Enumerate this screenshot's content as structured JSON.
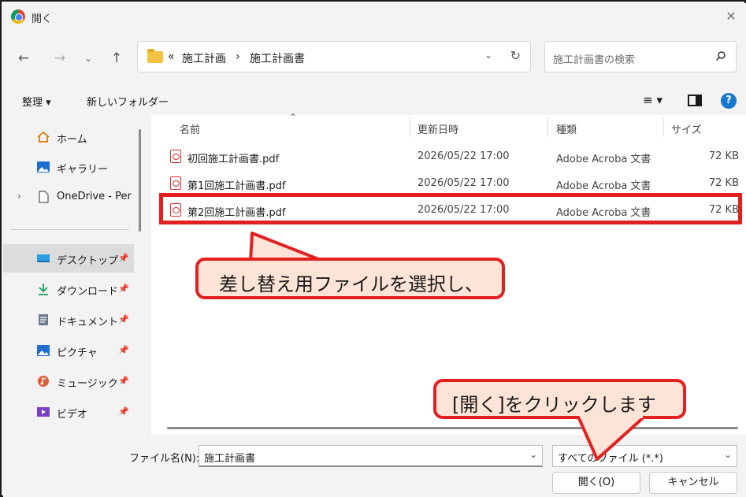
{
  "window": {
    "title": "開く"
  },
  "nav": {
    "breadcrumb_prefix": "«",
    "breadcrumb": [
      "施工計画",
      "施工計画書"
    ],
    "breadcrumb_sep": "›",
    "search_placeholder": "施工計画書の検索"
  },
  "toolbar": {
    "organize_label": "整理 ▾",
    "new_folder_label": "新しいフォルダー"
  },
  "sidebar": {
    "items": [
      {
        "label": "ホーム",
        "icon": "home-icon",
        "pinned": false
      },
      {
        "label": "ギャラリー",
        "icon": "gallery-icon",
        "pinned": false
      },
      {
        "label": "OneDrive - Per",
        "icon": "document-icon",
        "pinned": false
      },
      {
        "label": "デスクトップ",
        "icon": "desktop-icon",
        "pinned": true
      },
      {
        "label": "ダウンロード",
        "icon": "download-icon",
        "pinned": true
      },
      {
        "label": "ドキュメント",
        "icon": "documents-icon",
        "pinned": true
      },
      {
        "label": "ピクチャ",
        "icon": "pictures-icon",
        "pinned": true
      },
      {
        "label": "ミュージック",
        "icon": "music-icon",
        "pinned": true
      },
      {
        "label": "ビデオ",
        "icon": "video-icon",
        "pinned": true
      }
    ]
  },
  "files": {
    "columns": [
      "名前",
      "更新日時",
      "種類",
      "サイズ"
    ],
    "rows": [
      {
        "name": "初回施工計画書.pdf",
        "date": "2026/05/22 17:00",
        "type": "Adobe Acroba 文書",
        "size": "72 KB"
      },
      {
        "name": "第1回施工計画書.pdf",
        "date": "2026/05/22 17:00",
        "type": "Adobe Acroba 文書",
        "size": "72 KB"
      },
      {
        "name": "第2回施工計画書.pdf",
        "date": "2026/05/22 17:00",
        "type": "Adobe Acroba 文書",
        "size": "72 KB"
      }
    ],
    "selected_row": 2
  },
  "bottom": {
    "filename_label": "ファイル名(N):",
    "filename_value": "施工計画書",
    "filter_value": "すべてのファイル (*.*)",
    "open_button": "開く(O)",
    "cancel_button": "キャンセル"
  },
  "annotations": {
    "callout1": "差し替え用ファイルを選択し、",
    "callout2": "[開く]をクリックします"
  },
  "colors": {
    "accent_red": "#e32020",
    "callout_fill": "#fde4d6",
    "help_blue": "#1677d2"
  }
}
